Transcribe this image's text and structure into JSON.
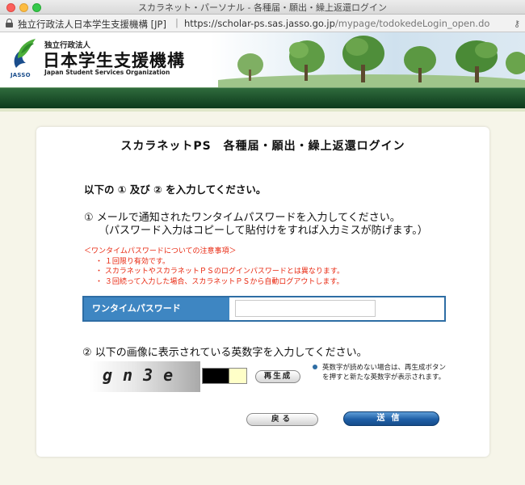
{
  "window": {
    "title": "スカラネット・パーソナル - 各種届・願出・繰上返還ログイン",
    "url_org": "独立行政法人日本学生支援機構 [JP]",
    "url_host": "https://scholar-ps.sas.jasso.go.jp",
    "url_path": "/mypage/todokedeLogin_open.do"
  },
  "header": {
    "org_small": "独立行政法人",
    "org_name": "日本学生支援機構",
    "org_english": "Japan Student Services Organization",
    "logo_text": "JASSO"
  },
  "page": {
    "title": "スカラネットPS　各種届・願出・繰上返還ログイン",
    "instruction": "以下の ① 及び ② を入力してください。",
    "step1_line1": "① メールで通知されたワンタイムパスワードを入力してください。",
    "step1_line2": "（パスワード入力はコピーして貼付けをすれば入力ミスが防げます。）",
    "notes_heading": "＜ワンタイムパスワードについての注意事項＞",
    "notes": [
      "・ １回限り有効です。",
      "・ スカラネットやスカラネットＰＳのログインパスワードとは異なります。",
      "・ ３回続って入力した場合、スカラネットＰＳから自動ログアウトします。"
    ],
    "otp_label": "ワンタイムパスワード",
    "otp_value": "",
    "otp_placeholder": "",
    "step2": "② 以下の画像に表示されている英数字を入力してください。",
    "captcha_text": "gn3e",
    "captcha_value": "",
    "regen_label": "再生成",
    "hint": "英数字が読めない場合は、再生成ボタンを押すと新たな英数字が表示されます。",
    "back_label": "戻る",
    "send_label": "送信"
  },
  "colors": {
    "accent_blue": "#3e86c2",
    "notice_red": "#e8260e",
    "header_green": "#0d3a1c"
  }
}
